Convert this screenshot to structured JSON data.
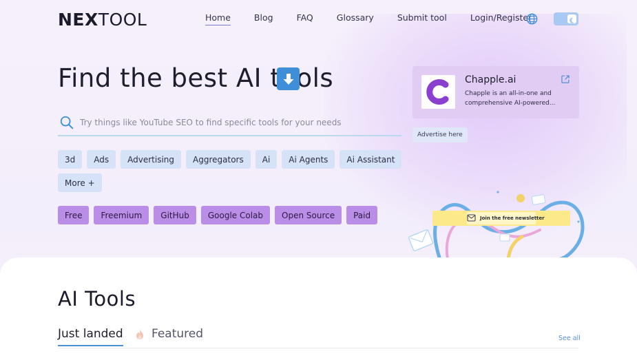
{
  "logo": {
    "part1": "NE",
    "part2": "X",
    "part3": "TOOL"
  },
  "nav": [
    {
      "label": "Home",
      "active": true
    },
    {
      "label": "Blog"
    },
    {
      "label": "FAQ"
    },
    {
      "label": "Glossary"
    },
    {
      "label": "Submit tool"
    },
    {
      "label": "Login/Register"
    }
  ],
  "hero": {
    "title": "Find the best AI tools",
    "search_placeholder": "Try things like YouTube SEO to find specific tools for your needs"
  },
  "categories": [
    "3d",
    "Ads",
    "Advertising",
    "Aggregators",
    "Ai",
    "Ai Agents",
    "Ai Assistant"
  ],
  "more_label": "More +",
  "pricing": [
    "Free",
    "Freemium",
    "GitHub",
    "Google Colab",
    "Open Source",
    "Paid"
  ],
  "ad": {
    "name": "Chapple.ai",
    "description": "Chapple is an all-in-one and comprehensive AI-powered...",
    "advertise_label": "Advertise here"
  },
  "newsletter": {
    "label": "Join the free newsletter"
  },
  "section": {
    "title": "AI Tools",
    "tabs": [
      "Just landed",
      "Featured"
    ],
    "see_all": "See all"
  },
  "colors": {
    "accent_blue": "#4d8fd6",
    "chip_blue": "#d5e2f7",
    "chip_purple": "#ba8ee6",
    "ad_card": "#e1ccf3"
  },
  "icons": {
    "globe": "globe-icon",
    "theme_toggle": "theme-toggle-icon",
    "download": "down-arrow-icon",
    "search": "search-icon",
    "external": "external-link-icon",
    "featured": "fire-icon"
  }
}
